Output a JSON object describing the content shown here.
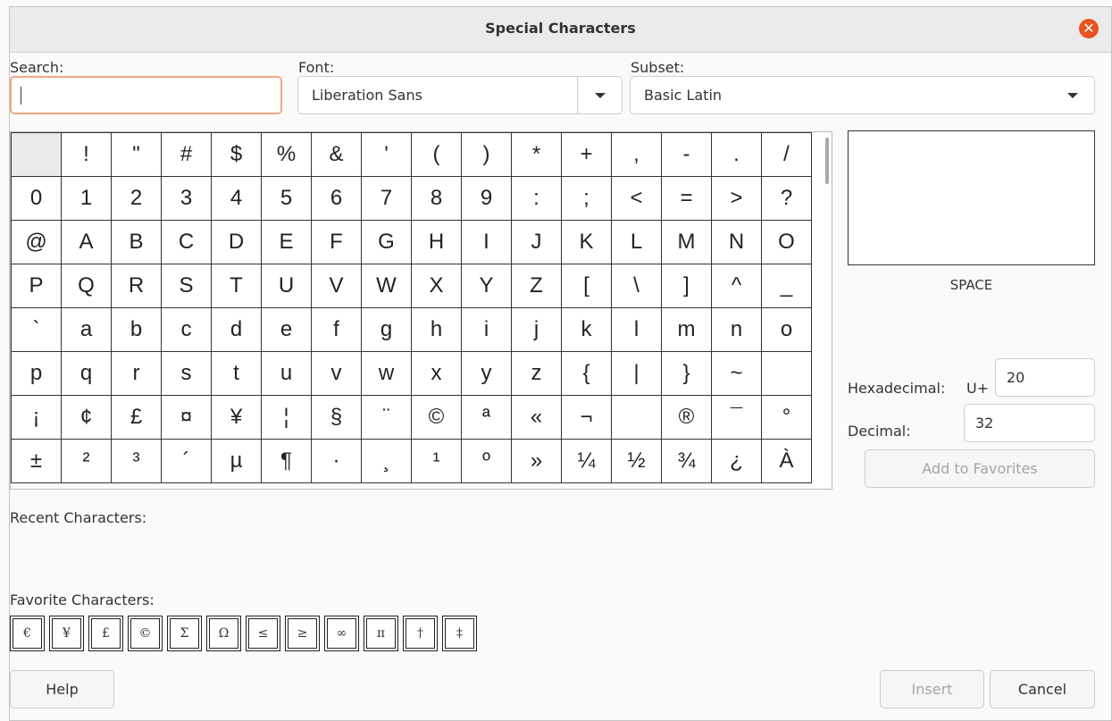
{
  "dialog": {
    "title": "Special Characters",
    "close_icon": "close-icon"
  },
  "search": {
    "label": "Search:",
    "value": "",
    "placeholder": ""
  },
  "font": {
    "label": "Font:",
    "value": "Liberation Sans"
  },
  "subset": {
    "label": "Subset:",
    "value": "Basic Latin"
  },
  "grid": {
    "rows": [
      [
        " ",
        "!",
        "\"",
        "#",
        "$",
        "%",
        "&",
        "'",
        "(",
        ")",
        "*",
        "+",
        ",",
        "-",
        ".",
        "/"
      ],
      [
        "0",
        "1",
        "2",
        "3",
        "4",
        "5",
        "6",
        "7",
        "8",
        "9",
        ":",
        ";",
        "<",
        "=",
        ">",
        "?"
      ],
      [
        "@",
        "A",
        "B",
        "C",
        "D",
        "E",
        "F",
        "G",
        "H",
        "I",
        "J",
        "K",
        "L",
        "M",
        "N",
        "O"
      ],
      [
        "P",
        "Q",
        "R",
        "S",
        "T",
        "U",
        "V",
        "W",
        "X",
        "Y",
        "Z",
        "[",
        "\\",
        "]",
        "^",
        "_"
      ],
      [
        "`",
        "a",
        "b",
        "c",
        "d",
        "e",
        "f",
        "g",
        "h",
        "i",
        "j",
        "k",
        "l",
        "m",
        "n",
        "o"
      ],
      [
        "p",
        "q",
        "r",
        "s",
        "t",
        "u",
        "v",
        "w",
        "x",
        "y",
        "z",
        "{",
        "|",
        "}",
        "~",
        " "
      ],
      [
        "¡",
        "¢",
        "£",
        "¤",
        "¥",
        "¦",
        "§",
        "¨",
        "©",
        "ª",
        "«",
        "¬",
        " ",
        "®",
        "¯",
        "°"
      ],
      [
        "±",
        "²",
        "³",
        "´",
        "µ",
        "¶",
        "·",
        "¸",
        "¹",
        "º",
        "»",
        "¼",
        "½",
        "¾",
        "¿",
        "À"
      ]
    ]
  },
  "detail": {
    "char_name": "SPACE",
    "hex_label": "Hexadecimal:",
    "hex_prefix": "U+",
    "hex_value": "20",
    "dec_label": "Decimal:",
    "dec_value": "32",
    "add_fav_label": "Add to Favorites"
  },
  "recent": {
    "label": "Recent Characters:"
  },
  "favorites": {
    "label": "Favorite Characters:",
    "items": [
      "€",
      "¥",
      "£",
      "©",
      "Σ",
      "Ω",
      "≤",
      "≥",
      "∞",
      "π",
      "†",
      "‡"
    ]
  },
  "buttons": {
    "help": "Help",
    "insert": "Insert",
    "cancel": "Cancel"
  }
}
